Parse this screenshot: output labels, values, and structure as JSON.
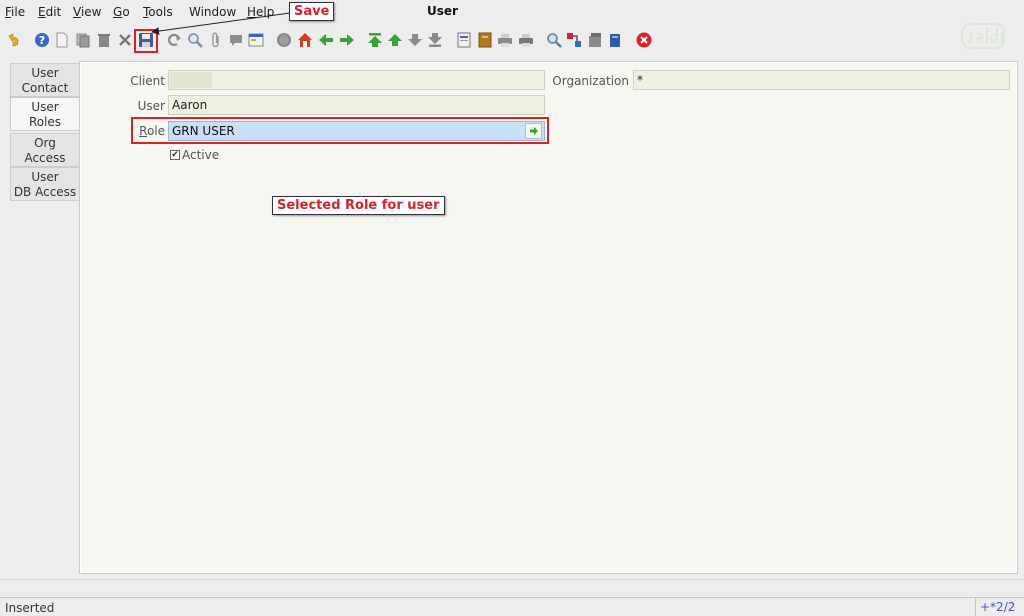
{
  "menu": {
    "file": {
      "hotkey": "F",
      "rest": "ile"
    },
    "edit": {
      "hotkey": "E",
      "rest": "dit"
    },
    "view": {
      "hotkey": "V",
      "rest": "iew"
    },
    "go": {
      "hotkey": "G",
      "rest": "o"
    },
    "tools": {
      "hotkey": "T",
      "rest": "ools"
    },
    "window": "Window",
    "help": {
      "hotkey": "H",
      "rest": "elp"
    }
  },
  "window_title": "User",
  "toolbar_icons": [
    "undo-icon",
    "help-icon",
    "new-record-icon",
    "copy-record-icon",
    "delete-icon",
    "delete-selection-icon",
    "save-icon",
    "refresh-icon",
    "find-icon",
    "attachment-icon",
    "chat-icon",
    "grid-toggle-icon",
    "history-icon",
    "home-icon",
    "parent-record-icon",
    "detail-record-icon",
    "first-record-icon",
    "previous-record-icon",
    "next-record-icon",
    "last-record-icon",
    "report-icon",
    "archive-icon",
    "print-preview-icon",
    "print-icon",
    "zoom-across-icon",
    "active-workflows-icon",
    "requests-icon",
    "product-info-icon",
    "close-window-icon"
  ],
  "annotations": {
    "save_callout": "Save",
    "role_callout": "Selected Role for user"
  },
  "tabs": [
    {
      "line1": "User",
      "line2": "Contact"
    },
    {
      "line1": "User",
      "line2": "Roles"
    },
    {
      "line1": "Org",
      "line2": "Access"
    },
    {
      "line1": "User",
      "line2": "DB Access"
    }
  ],
  "form": {
    "client_label": "Client",
    "client_value": "",
    "organization_label": "Organization",
    "organization_value": "*",
    "user_label": "User",
    "user_value": "Aaron",
    "role_label_hotkey": "R",
    "role_label_rest": "ole",
    "role_value": "GRN USER",
    "active_label": "Active",
    "active_checked": true
  },
  "status": {
    "text": "Inserted",
    "record_count": "+*2/2"
  },
  "colors": {
    "annotation_red": "#d8232a",
    "selected_field_blue": "#c9dff3",
    "record_count_blue": "#4a56c8"
  }
}
